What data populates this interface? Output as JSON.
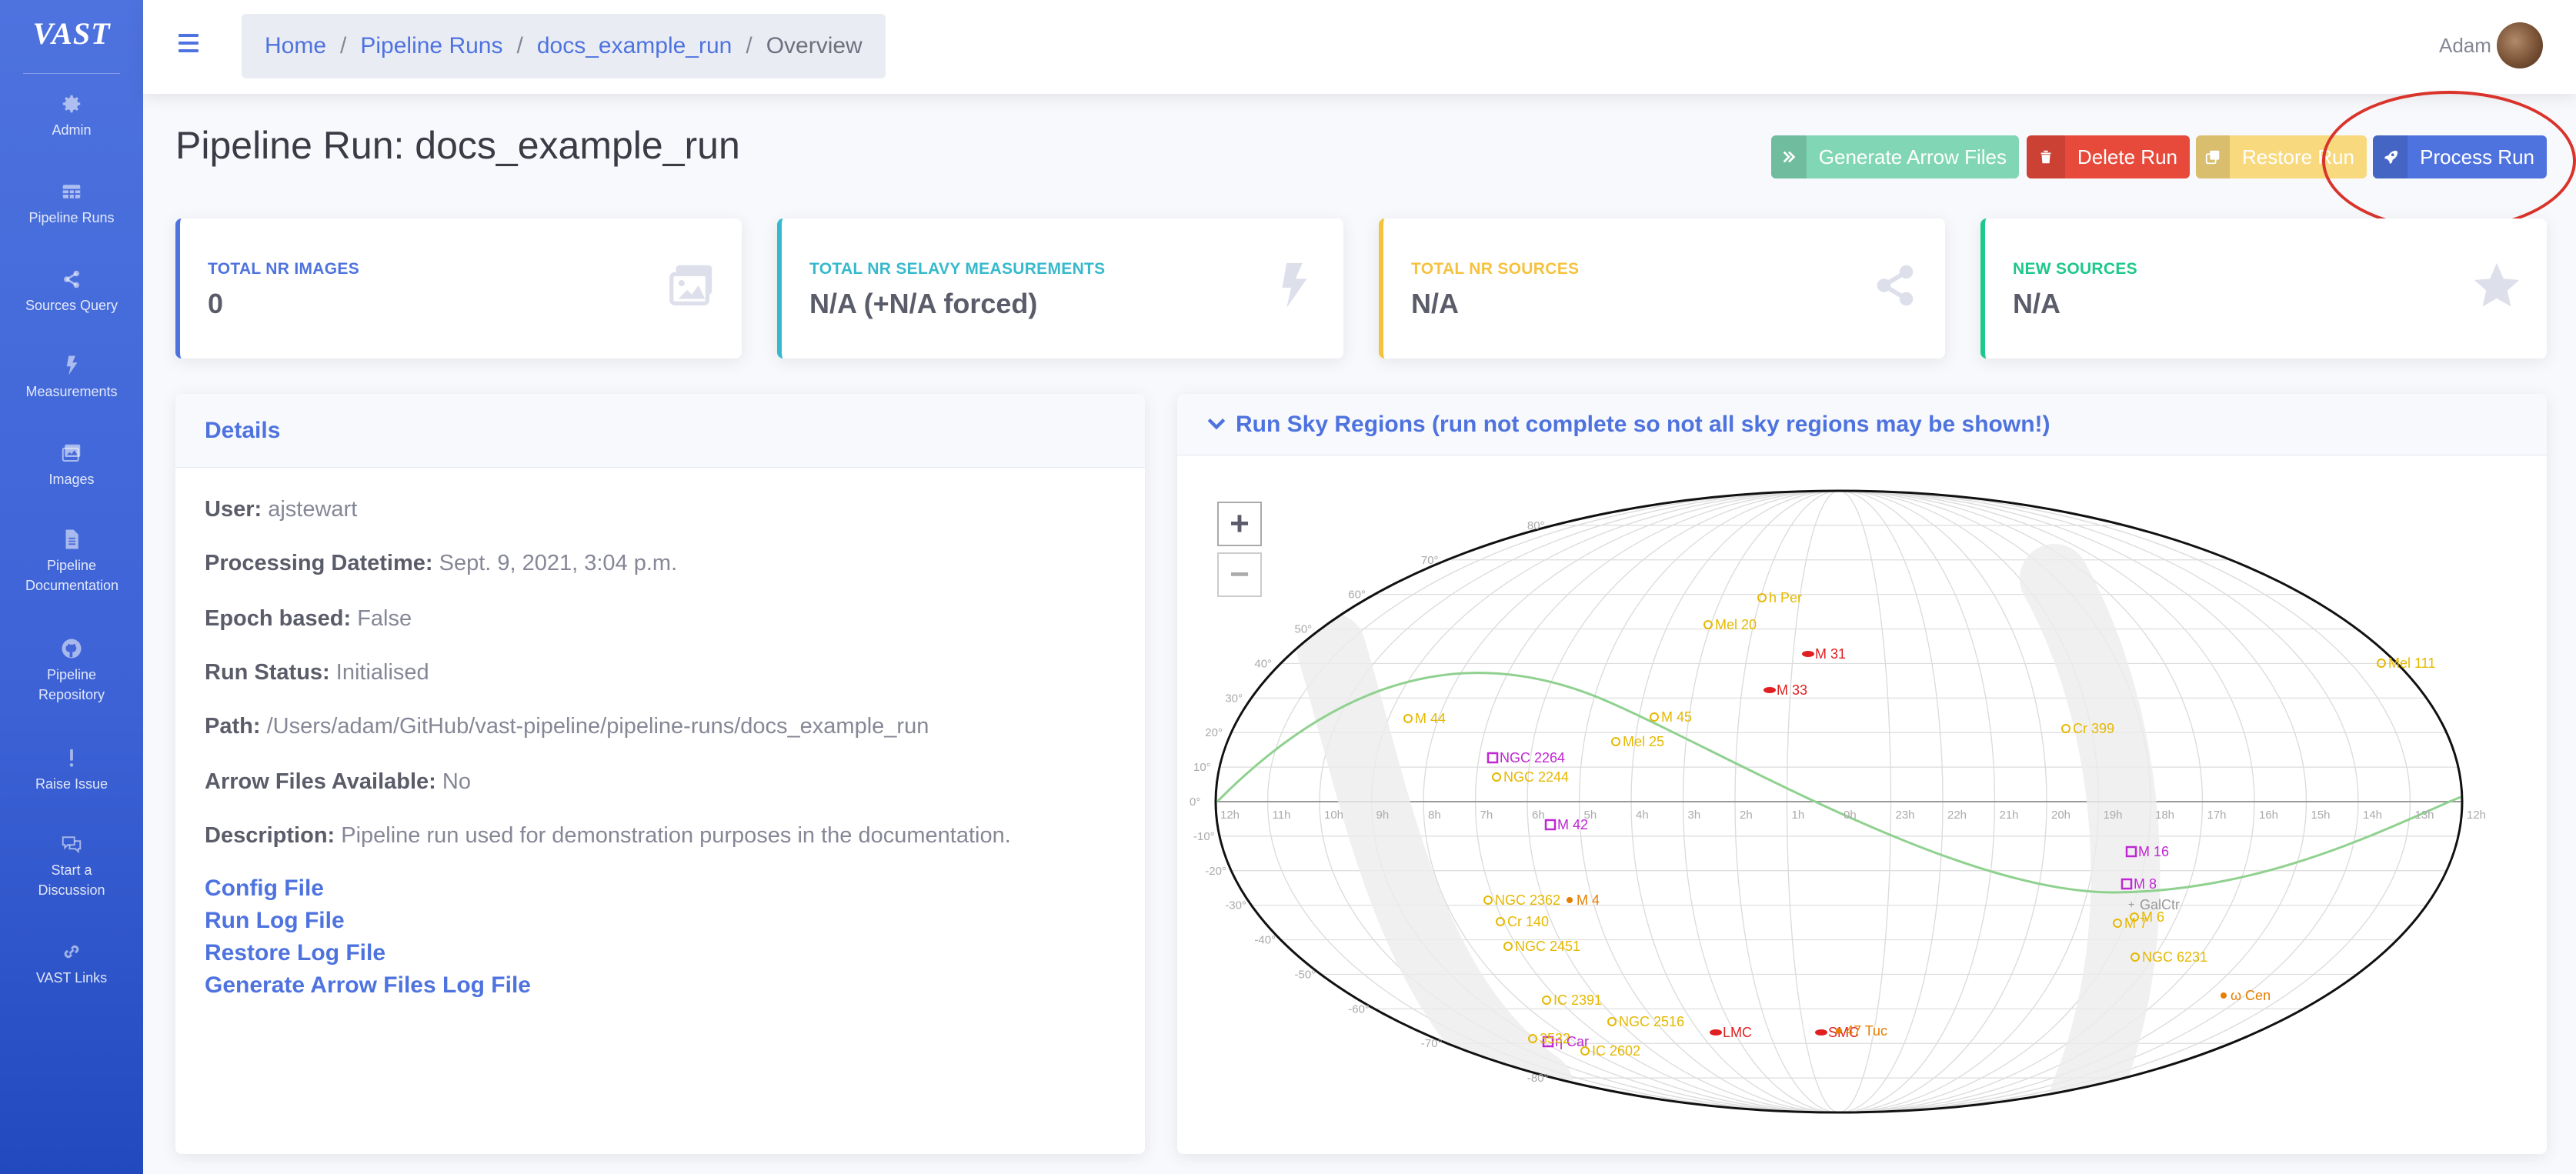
{
  "brand": "VAST",
  "sidebar": {
    "items": [
      {
        "label": "Admin",
        "icon": "gear-icon"
      },
      {
        "label": "Pipeline Runs",
        "icon": "table-icon"
      },
      {
        "label": "Sources Query",
        "icon": "share-icon"
      },
      {
        "label": "Measurements",
        "icon": "bolt-icon"
      },
      {
        "label": "Images",
        "icon": "images-icon"
      },
      {
        "label": "Pipeline Documentation",
        "icon": "file-icon"
      },
      {
        "label": "Pipeline Repository",
        "icon": "github-icon"
      },
      {
        "label": "Raise Issue",
        "icon": "exclamation-icon"
      },
      {
        "label": "Start a Discussion",
        "icon": "comments-icon"
      },
      {
        "label": "VAST Links",
        "icon": "link-icon"
      }
    ]
  },
  "topbar": {
    "breadcrumb": [
      "Home",
      "Pipeline Runs",
      "docs_example_run",
      "Overview"
    ],
    "user": "Adam"
  },
  "page": {
    "title": "Pipeline Run: docs_example_run",
    "actions": [
      {
        "label": "Generate Arrow Files",
        "color": "#80d6b5"
      },
      {
        "label": "Delete Run",
        "color": "#e74a3b"
      },
      {
        "label": "Restore Run",
        "color": "#f8d97e"
      },
      {
        "label": "Process Run",
        "color": "#4e73df"
      }
    ]
  },
  "stats": [
    {
      "label": "Total Nr Images",
      "value": "0",
      "color": "#4e73df",
      "icon": "images-icon"
    },
    {
      "label": "Total Nr Selavy Measurements",
      "value": "N/A (+N/A forced)",
      "color": "#36b9cc",
      "icon": "bolt-icon"
    },
    {
      "label": "Total Nr Sources",
      "value": "N/A",
      "color": "#f6c23e",
      "icon": "share-icon"
    },
    {
      "label": "New Sources",
      "value": "N/A",
      "color": "#1cc88a",
      "icon": "star-icon"
    }
  ],
  "details": {
    "title": "Details",
    "rows": [
      {
        "key": "User:",
        "value": "ajstewart"
      },
      {
        "key": "Processing Datetime:",
        "value": "Sept. 9, 2021, 3:04 p.m."
      },
      {
        "key": "Epoch based:",
        "value": "False"
      },
      {
        "key": "Run Status:",
        "value": "Initialised"
      },
      {
        "key": "Path:",
        "value": "/Users/adam/GitHub/vast-pipeline/pipeline-runs/docs_example_run"
      },
      {
        "key": "Arrow Files Available:",
        "value": "No"
      },
      {
        "key": "Description:",
        "value": "Pipeline run used for demonstration purposes in the documentation."
      }
    ],
    "links": [
      "Config File",
      "Run Log File",
      "Restore Log File",
      "Generate Arrow Files Log File"
    ]
  },
  "sky": {
    "title": "Run Sky Regions (run not complete so not all sky regions may be shown!)",
    "zoom_in": "+",
    "zoom_out": "−",
    "ra_labels": [
      "12h",
      "11h",
      "10h",
      "9h",
      "8h",
      "7h",
      "6h",
      "5h",
      "4h",
      "3h",
      "2h",
      "1h",
      "0h",
      "23h",
      "22h",
      "21h",
      "20h",
      "19h",
      "18h",
      "17h",
      "16h",
      "15h",
      "14h",
      "13h",
      "12h"
    ],
    "dec_labels_left": [
      "80°",
      "70°",
      "60°",
      "50°",
      "40°",
      "30°",
      "20°",
      "10°",
      "0°",
      "-10°",
      "-20°",
      "-30°",
      "-40°",
      "-50°",
      "-60°",
      "-70°",
      "-80°"
    ],
    "objects": [
      {
        "name": "h Per",
        "type": "open",
        "color": "#e6b800"
      },
      {
        "name": "Mel 20",
        "type": "open",
        "color": "#e6b800"
      },
      {
        "name": "M 31",
        "type": "galaxy",
        "color": "#e02020"
      },
      {
        "name": "M 33",
        "type": "galaxy",
        "color": "#e02020"
      },
      {
        "name": "M 44",
        "type": "open",
        "color": "#e6b800"
      },
      {
        "name": "M 45",
        "type": "open",
        "color": "#e6b800"
      },
      {
        "name": "Mel 25",
        "type": "open",
        "color": "#e6b800"
      },
      {
        "name": "NGC 2264",
        "type": "nebula",
        "color": "#c026d3"
      },
      {
        "name": "NGC 2244",
        "type": "open",
        "color": "#e6b800"
      },
      {
        "name": "M 42",
        "type": "nebula",
        "color": "#c026d3"
      },
      {
        "name": "Cr 399",
        "type": "open",
        "color": "#e6b800"
      },
      {
        "name": "Mel 111",
        "type": "open",
        "color": "#e6b800"
      },
      {
        "name": "M 16",
        "type": "nebula",
        "color": "#c026d3"
      },
      {
        "name": "M 8",
        "type": "nebula",
        "color": "#c026d3"
      },
      {
        "name": "GalCtr",
        "type": "marker",
        "color": "#999999"
      },
      {
        "name": "M 6",
        "type": "open",
        "color": "#e6b800"
      },
      {
        "name": "M 7",
        "type": "open",
        "color": "#e6b800"
      },
      {
        "name": "NGC 6231",
        "type": "open",
        "color": "#e6b800"
      },
      {
        "name": "NGC 2362",
        "type": "open",
        "color": "#e6b800"
      },
      {
        "name": "M 4",
        "type": "globular",
        "color": "#e67e00"
      },
      {
        "name": "Cr 140",
        "type": "open",
        "color": "#e6b800"
      },
      {
        "name": "NGC 2451",
        "type": "open",
        "color": "#e6b800"
      },
      {
        "name": "IC 2391",
        "type": "open",
        "color": "#e6b800"
      },
      {
        "name": "NGC 2516",
        "type": "open",
        "color": "#e6b800"
      },
      {
        "name": "η Car",
        "type": "nebula",
        "color": "#c026d3"
      },
      {
        "name": "3532",
        "type": "open",
        "color": "#e6b800"
      },
      {
        "name": "IC 2602",
        "type": "open",
        "color": "#e6b800"
      },
      {
        "name": "LMC",
        "type": "galaxy",
        "color": "#e02020"
      },
      {
        "name": "SMC",
        "type": "galaxy",
        "color": "#e02020"
      },
      {
        "name": "47 Tuc",
        "type": "globular",
        "color": "#e67e00"
      },
      {
        "name": "ω Cen",
        "type": "globular",
        "color": "#e67e00"
      }
    ]
  }
}
